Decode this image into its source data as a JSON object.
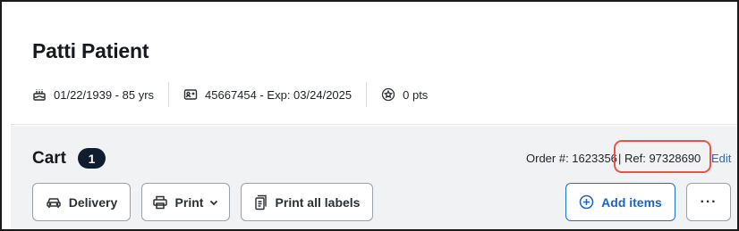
{
  "patient": {
    "name": "Patti Patient",
    "dob": "01/22/1939 - 85 yrs",
    "id_exp": "45667454 - Exp: 03/24/2025",
    "points": "0 pts"
  },
  "cart": {
    "title": "Cart",
    "count": "1",
    "order_number": "Order #: 1623356",
    "ref": "| Ref: 97328690",
    "edit_label": "Edit",
    "buttons": {
      "delivery": "Delivery",
      "print": "Print",
      "print_all_labels": "Print all labels",
      "add_items": "Add items",
      "more": "···"
    }
  },
  "colors": {
    "accent": "#1a6cd6",
    "badge": "#0f1d2e",
    "highlight": "#e3574a"
  },
  "icons": [
    "cake-icon",
    "id-card-icon",
    "star-badge-icon",
    "car-icon",
    "printer-icon",
    "chevron-down-icon",
    "labels-icon",
    "plus-circle-icon",
    "more-icon"
  ]
}
